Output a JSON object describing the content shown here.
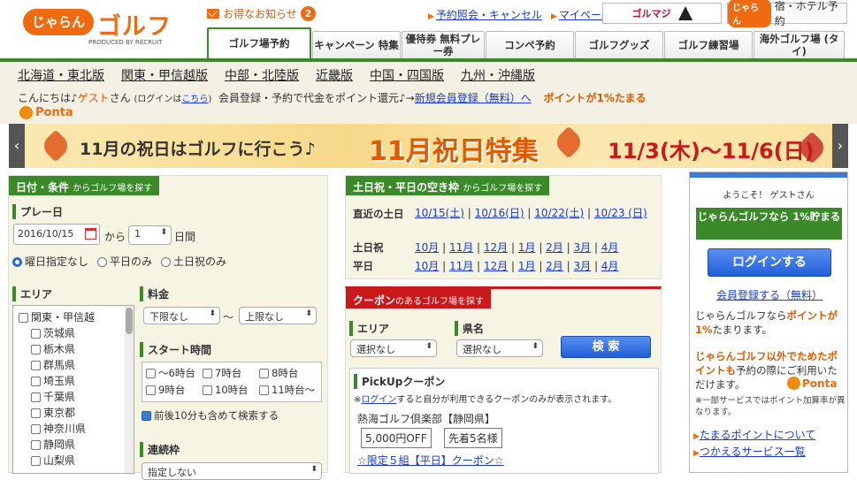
{
  "header": {
    "logo_text": "じゃらん",
    "logo_golf": "ゴルフ",
    "logo_sub": "PRODUCED BY RECRUIT",
    "deal_label": "お得なお知らせ",
    "deal_count": "2",
    "toplinks": [
      "予約照会・キャンセル",
      "マイページ"
    ],
    "golfmagic": "ゴルマジ",
    "hotel_logo": "じゃらん",
    "hotel_label": "宿・ホテル予約"
  },
  "tabs": [
    "ゴルフ場予約",
    "キャンペーン 特集",
    "優待券 無料プレー券",
    "コンペ予約",
    "ゴルフグッズ",
    "ゴルフ練習場",
    "海外ゴルフ場 (タイ)"
  ],
  "regions": [
    "北海道・東北版",
    "関東・甲信越版",
    "中部・北陸版",
    "近畿版",
    "中国・四国版",
    "九州・沖縄版"
  ],
  "greeting": {
    "hello": "こんにちは♪",
    "guest": "ゲスト",
    "san": "さん",
    "login_pre": "(ログインは",
    "login_link": "こちら",
    "login_post": ")",
    "reg_text": "会員登録・予約で代金をポイント還元♪→",
    "reg_link": "新規会員登録（無料）へ",
    "points": "ポイントが1%たまる",
    "ponta": "Ponta"
  },
  "banner": {
    "t1": "11月の祝日はゴルフに行こう♪",
    "t2": "11月祝日特集",
    "t3": "11/3(木)～11/6(日)"
  },
  "search": {
    "head": "日付・条件",
    "head_sub": "からゴルフ場を探す",
    "play_label": "プレー日",
    "date": "2016/10/15",
    "kara": "から",
    "days": "1",
    "days_unit": "日間",
    "radios": [
      "曜日指定なし",
      "平日のみ",
      "土日祝のみ"
    ],
    "area_label": "エリア",
    "areas": [
      "関東・甲信越",
      "茨城県",
      "栃木県",
      "群馬県",
      "埼玉県",
      "千葉県",
      "東京都",
      "神奈川県",
      "静岡県",
      "山梨県"
    ],
    "fee_label": "料金",
    "fee_min": "下限なし",
    "tilde": "～",
    "fee_max": "上限なし",
    "start_label": "スタート時間",
    "times": [
      "～6時台",
      "7時台",
      "8時台",
      "9時台",
      "10時台",
      "11時台～"
    ],
    "before_after": "前後10分も含めて検索する",
    "renzoku_label": "連続枠",
    "renzoku_val": "指定しない"
  },
  "holiday": {
    "head": "土日祝・平日の空き枠",
    "head_sub": "からゴルフ場を探す",
    "recent_label": "直近の土日",
    "recent": [
      "10/15(土)",
      "10/16(日)",
      "10/22(土)",
      "10/23 (日)"
    ],
    "weekend_label": "土日祝",
    "weekday_label": "平日",
    "months": [
      "10月",
      "11月",
      "12月",
      "1月",
      "2月",
      "3月",
      "4月"
    ]
  },
  "coupon": {
    "head": "クーポン",
    "head_sub": "のあるゴルフ場を探す",
    "area_label": "エリア",
    "pref_label": "県名",
    "area_val": "選択なし",
    "pref_val": "選択なし",
    "search_btn": "検 索",
    "pickup_label": "PickUpクーポン",
    "note_pre": "※",
    "note_link": "ログイン",
    "note_post": "すると自分が利用できるクーポンのみが表示されます。",
    "club": "熱海ゴルフ倶楽部【静岡県】",
    "price": "5,000円OFF",
    "limit": "先着5名様",
    "more_link": "☆限定５組【平日】クーポン☆"
  },
  "side": {
    "welcome": "ようこそ！ ゲストさん",
    "save_btn": "じゃらんゴルフなら 1%貯まる",
    "login_btn": "ログインする",
    "register": "会員登録する（無料）",
    "t1a": "じゃらんゴルフなら",
    "t1b": "ポイントが1%",
    "t1c": "たまります。",
    "t2a": "じゃらんゴルフ以外でためたポイントも",
    "t2b": "予約の際にご利用いただけます。",
    "ponta": "Ponta",
    "note": "※一部サービスではポイント加算率が異なります。",
    "links": [
      "たまるポイントについて",
      "つかえるサービス一覧"
    ]
  }
}
